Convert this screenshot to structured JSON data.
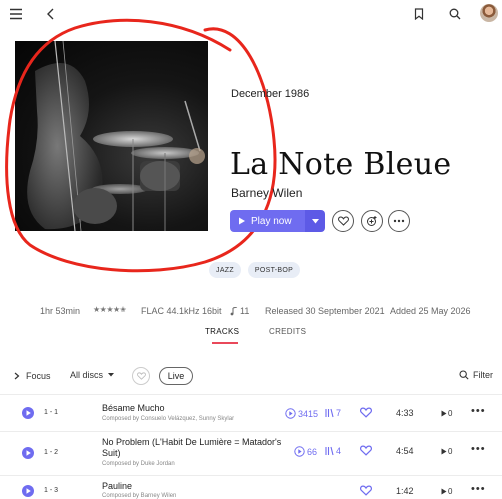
{
  "album": {
    "date": "December 1986",
    "title": "La Note Bleue",
    "artist": "Barney Wilen",
    "play_label": "Play now"
  },
  "tags": [
    "JAZZ",
    "POST-BOP"
  ],
  "meta": {
    "duration": "1hr 53min",
    "rating_stars": 4.5,
    "quality": "FLAC 44.1kHz 16bit",
    "track_count": "11",
    "released": "Released 30 September 2021",
    "added": "Added 25 May 2026"
  },
  "tabs": [
    "TRACKS",
    "CREDITS"
  ],
  "active_tab": "TRACKS",
  "filters": {
    "focus": "Focus",
    "discs": "All discs",
    "live": "Live",
    "filter": "Filter"
  },
  "tracks": [
    {
      "num": "1 - 1",
      "title": "Bésame Mucho",
      "composer": "Composed by Consuelo Velázquez, Sunny Skylar",
      "plays": "3415",
      "versions": "7",
      "duration": "4:33",
      "performers": "0"
    },
    {
      "num": "1 - 2",
      "title": "No Problem (L'Habit De Lumière = Matador's Suit)",
      "composer": "Composed by Duke Jordan",
      "plays": "66",
      "versions": "4",
      "duration": "4:54",
      "performers": "0"
    },
    {
      "num": "1 - 3",
      "title": "Pauline",
      "composer": "Composed by Barney Wilen",
      "plays": "",
      "versions": "",
      "duration": "1:42",
      "performers": "0"
    }
  ],
  "colors": {
    "accent": "#6f6cf0",
    "tab_underline": "#e9485a",
    "annotation": "#e8261c"
  }
}
